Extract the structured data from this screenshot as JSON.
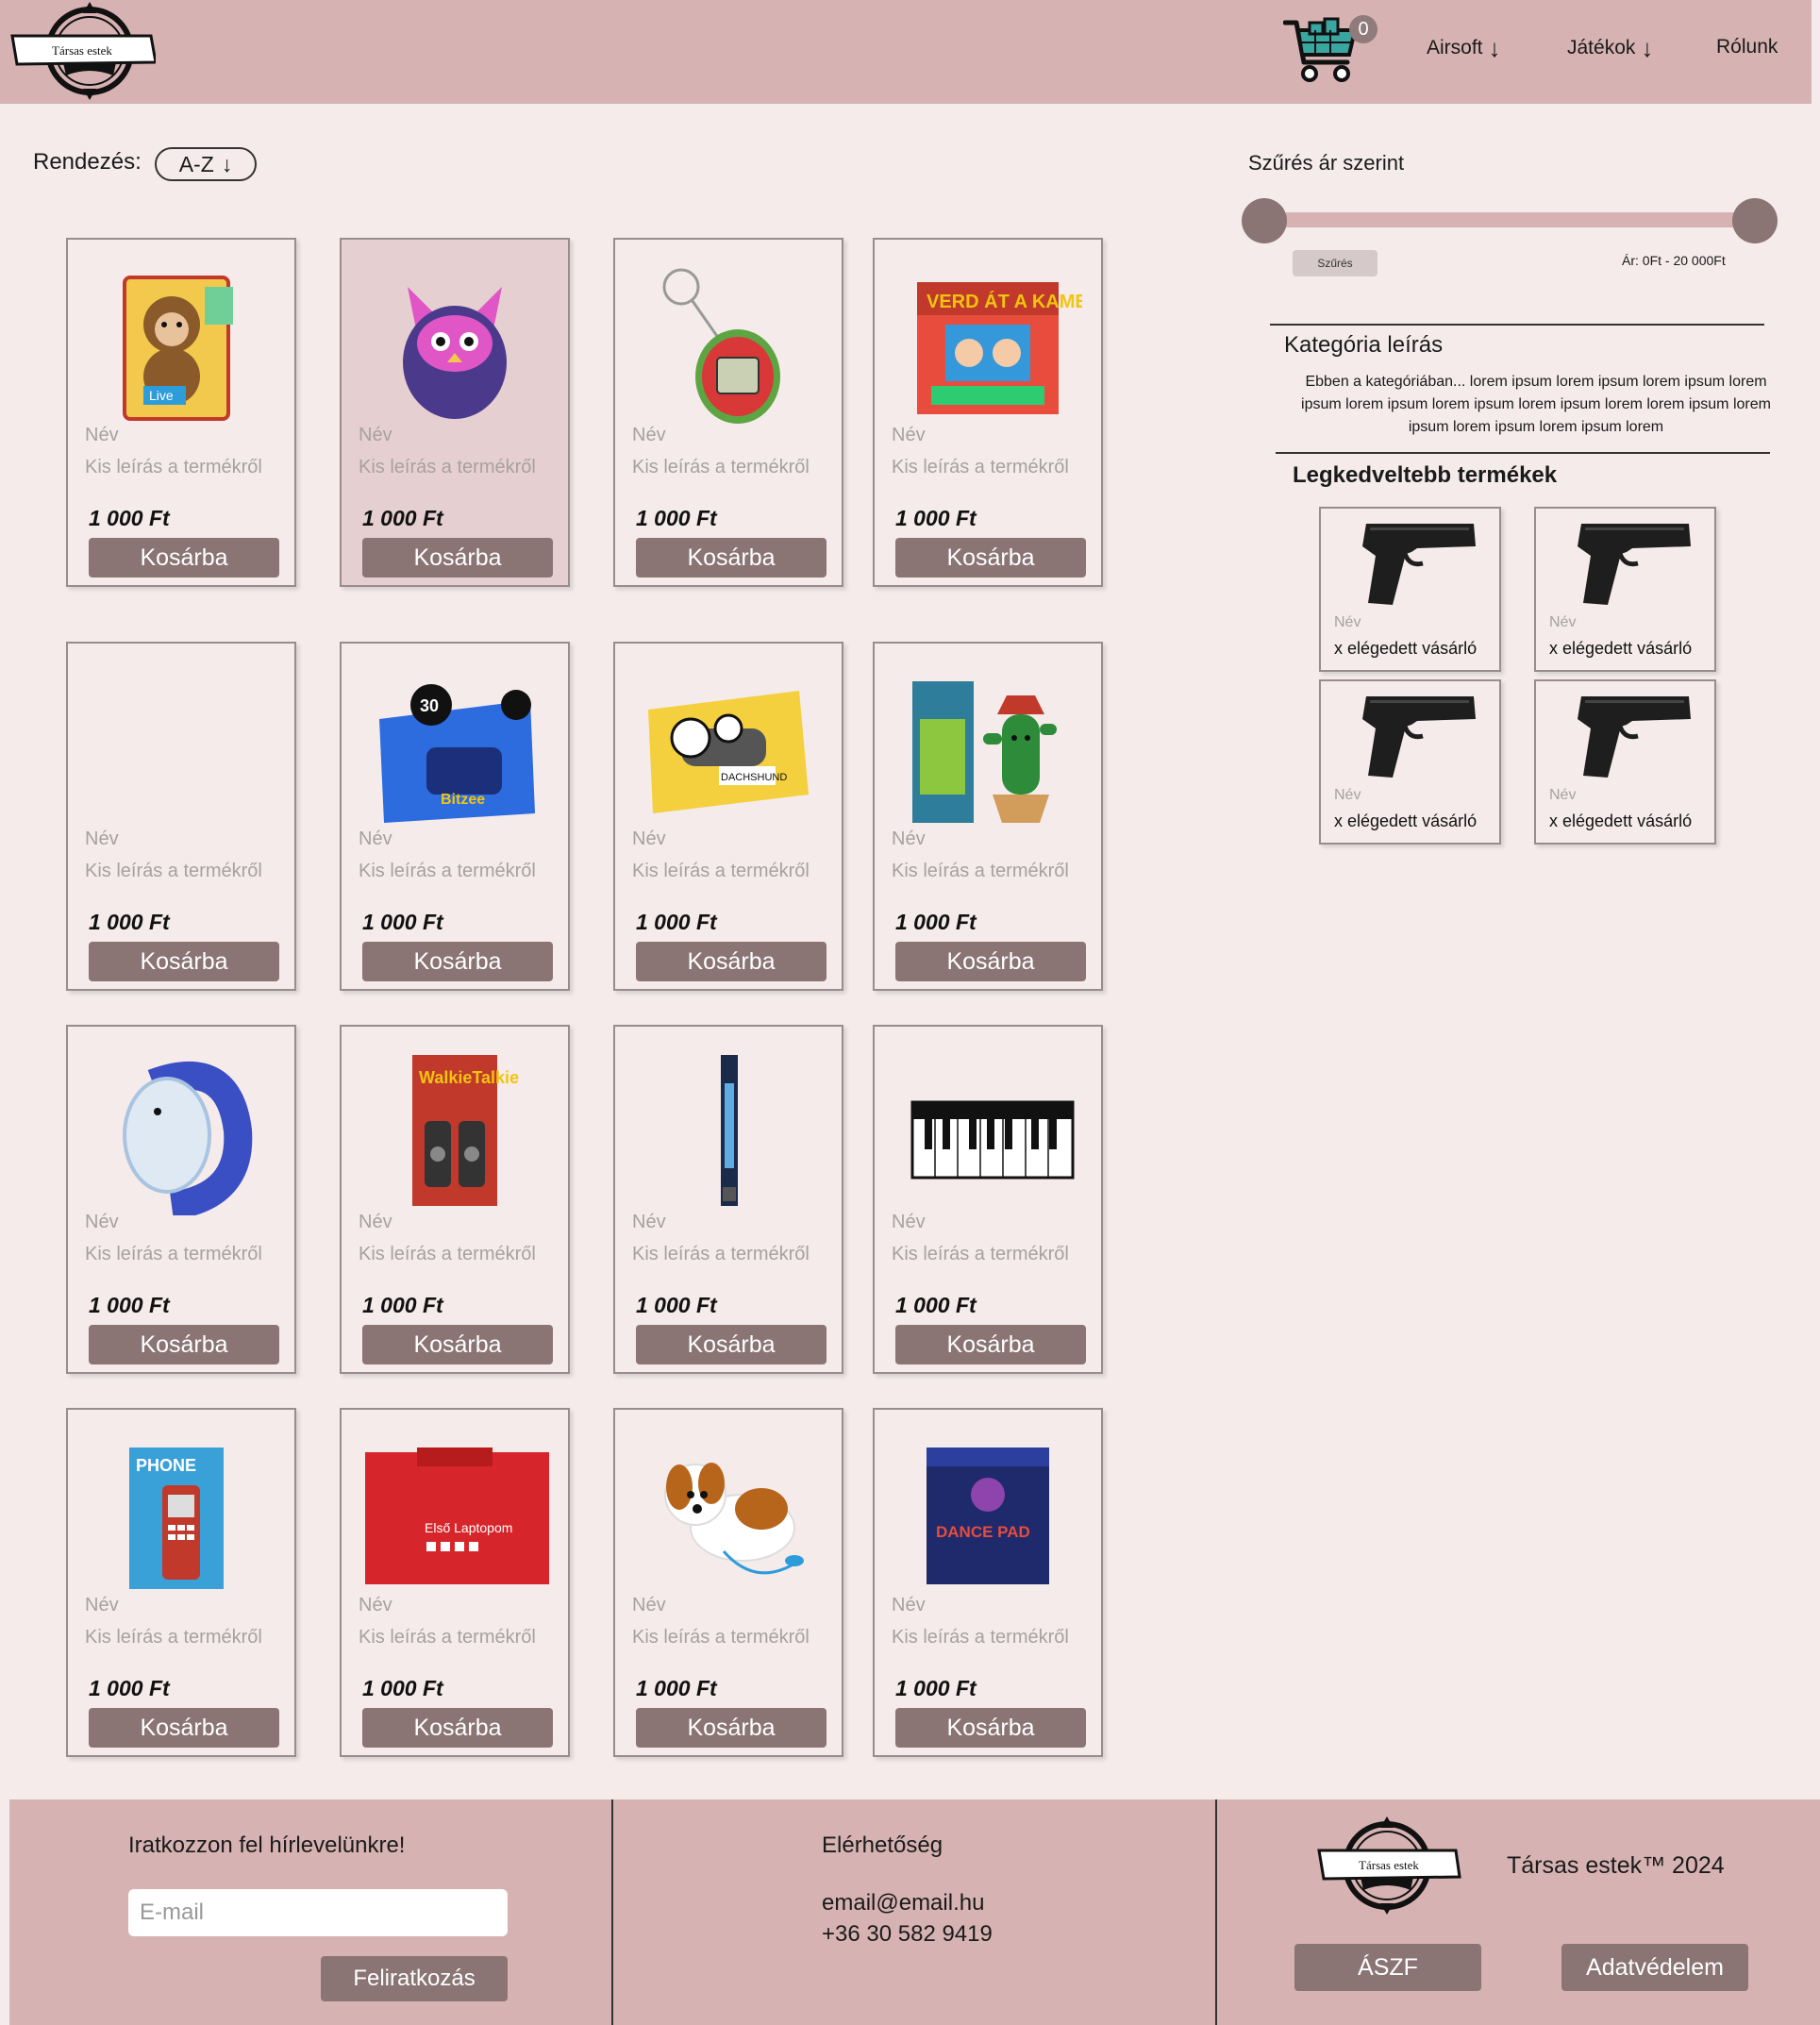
{
  "header": {
    "logo_text": "Társas estek",
    "cart_count": "0",
    "nav": [
      {
        "label": "Airsoft",
        "arrow": "↓"
      },
      {
        "label": "Játékok",
        "arrow": "↓"
      },
      {
        "label": "Rólunk"
      }
    ]
  },
  "sort": {
    "label": "Rendezés:",
    "value": "A-Z",
    "arrow": "↓"
  },
  "products": [
    {
      "image": "monkey-toy",
      "name": "Név",
      "desc": "Kis leírás a termékről",
      "price": "1 000 Ft",
      "button": "Kosárba"
    },
    {
      "image": "furby-toy",
      "name": "Név",
      "desc": "Kis leírás a termékről",
      "price": "1 000 Ft",
      "button": "Kosárba",
      "highlighted": true
    },
    {
      "image": "tamagotchi-keychain",
      "name": "Név",
      "desc": "Kis leírás a termékről",
      "price": "1 000 Ft",
      "button": "Kosárba"
    },
    {
      "image": "board-game-box",
      "name": "Név",
      "desc": "Kis leírás a termékről",
      "price": "1 000 Ft",
      "button": "Kosárba"
    },
    {
      "image": "",
      "name": "Név",
      "desc": "Kis leírás a termékről",
      "price": "1 000 Ft",
      "button": "Kosárba"
    },
    {
      "image": "bitzee-toy",
      "name": "Név",
      "desc": "Kis leírás a termékről",
      "price": "1 000 Ft",
      "button": "Kosárba"
    },
    {
      "image": "robot-dog-box",
      "name": "Név",
      "desc": "Kis leírás a termékről",
      "price": "1 000 Ft",
      "button": "Kosárba"
    },
    {
      "image": "dancing-cactus",
      "name": "Név",
      "desc": "Kis leírás a termékről",
      "price": "1 000 Ft",
      "button": "Kosárba"
    },
    {
      "image": "kids-smartwatch",
      "name": "Név",
      "desc": "Kis leírás a termékről",
      "price": "1 000 Ft",
      "button": "Kosárba"
    },
    {
      "image": "walkie-talkie",
      "name": "Név",
      "desc": "Kis leírás a termékről",
      "price": "1 000 Ft",
      "button": "Kosárba"
    },
    {
      "image": "lightsaber",
      "name": "Név",
      "desc": "Kis leírás a termékről",
      "price": "1 000 Ft",
      "button": "Kosárba"
    },
    {
      "image": "piano-mat",
      "name": "Név",
      "desc": "Kis leírás a termékről",
      "price": "1 000 Ft",
      "button": "Kosárba"
    },
    {
      "image": "toy-phone",
      "name": "Név",
      "desc": "Kis leírás a termékről",
      "price": "1 000 Ft",
      "button": "Kosárba"
    },
    {
      "image": "toy-laptop",
      "name": "Név",
      "desc": "Kis leírás a termékről",
      "price": "1 000 Ft",
      "button": "Kosárba"
    },
    {
      "image": "toy-puppy",
      "name": "Név",
      "desc": "Kis leírás a termékről",
      "price": "1 000 Ft",
      "button": "Kosárba"
    },
    {
      "image": "dance-pad",
      "name": "Név",
      "desc": "Kis leírás a termékről",
      "price": "1 000 Ft",
      "button": "Kosárba"
    }
  ],
  "filter": {
    "title": "Szűrés ár szerint",
    "min_fraction": 0,
    "max_fraction": 1,
    "button": "Szűrés",
    "range_text": "Ár: 0Ft - 20 000Ft"
  },
  "category": {
    "title": "Kategória leírás",
    "text": "Ebben a kategóriában... lorem ipsum lorem ipsum lorem ipsum lorem ipsum lorem ipsum lorem ipsum lorem ipsum lorem lorem ipsum lorem ipsum lorem ipsum lorem ipsum lorem"
  },
  "popular": {
    "title": "Legkedveltebb termékek",
    "items": [
      {
        "image": "pistol",
        "name": "Név",
        "rating": "x elégedett vásárló"
      },
      {
        "image": "pistol",
        "name": "Név",
        "rating": "x elégedett vásárló"
      },
      {
        "image": "pistol",
        "name": "Név",
        "rating": "x elégedett vásárló"
      },
      {
        "image": "pistol",
        "name": "Név",
        "rating": "x elégedett vásárló"
      }
    ]
  },
  "footer": {
    "newsletter_title": "Iratkozzon fel hírlevelünkre!",
    "email_placeholder": "E-mail",
    "subscribe_button": "Feliratkozás",
    "contact_title": "Elérhetőség",
    "email": "email@email.hu",
    "phone": "+36 30 582 9419",
    "logo_text": "Társas estek",
    "copyright": "Társas estek™ 2024",
    "aszf_button": "ÁSZF",
    "privacy_button": "Adatvédelem"
  },
  "colors": {
    "header_bg": "#d6b3b2",
    "page_bg": "#f5ebeb",
    "button_bg": "#8a7474"
  }
}
